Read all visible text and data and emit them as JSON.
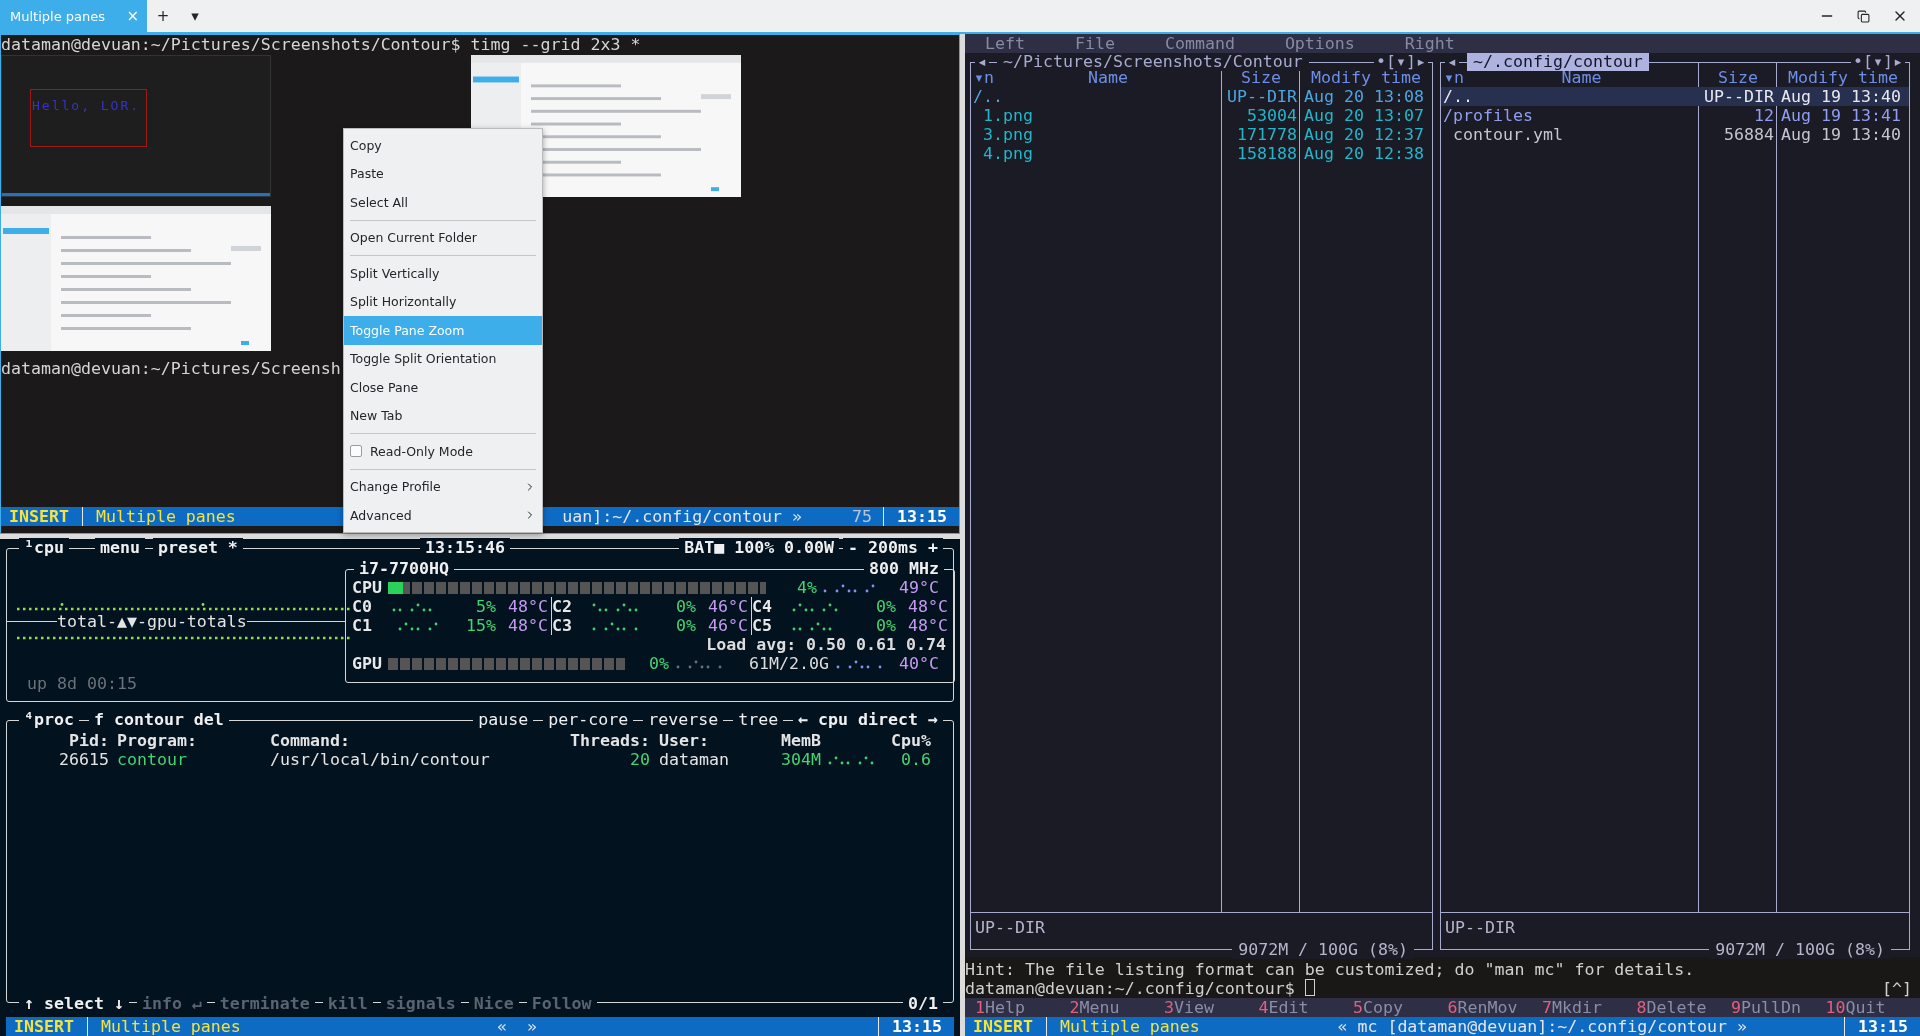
{
  "tab_bar": {
    "tabs": [
      {
        "label": "Multiple panes",
        "selected": true,
        "close": "×"
      }
    ],
    "new_tab": "+",
    "dropdown": "▾"
  },
  "top_pane": {
    "command_line": "dataman@devuan:~/Pictures/Screenshots/Contour$ timg --grid 2x3 *",
    "thumbnails": [
      {
        "kind": "terminal",
        "text": "Hello, LOR."
      },
      {
        "kind": "picture"
      },
      {
        "kind": "picture"
      }
    ],
    "prompt": "dataman@devuan:~/Pictures/Screensh",
    "status": {
      "mode": "INSERT",
      "title": "Multiple panes",
      "middle": "uan]:~/.config/contour »",
      "count": "75",
      "time": "13:15"
    }
  },
  "context_menu": {
    "items": [
      {
        "kind": "item",
        "label": "Copy",
        "selected": false
      },
      {
        "kind": "item",
        "label": "Paste",
        "selected": false
      },
      {
        "kind": "item",
        "label": "Select All",
        "selected": false
      },
      {
        "kind": "separator"
      },
      {
        "kind": "item",
        "label": "Open Current Folder",
        "selected": false
      },
      {
        "kind": "separator"
      },
      {
        "kind": "item",
        "label": "Split Vertically",
        "selected": false
      },
      {
        "kind": "item",
        "label": "Split Horizontally",
        "selected": false
      },
      {
        "kind": "item",
        "label": "Toggle Pane Zoom",
        "selected": true
      },
      {
        "kind": "item",
        "label": "Toggle Split Orientation",
        "selected": false
      },
      {
        "kind": "item",
        "label": "Close Pane",
        "selected": false
      },
      {
        "kind": "item",
        "label": "New Tab",
        "selected": false
      },
      {
        "kind": "separator"
      },
      {
        "kind": "checkbox",
        "label": "Read-Only Mode",
        "checked": false,
        "selected": false
      },
      {
        "kind": "separator"
      },
      {
        "kind": "submenu",
        "label": "Change Profile",
        "selected": false
      },
      {
        "kind": "submenu",
        "label": "Advanced",
        "selected": false
      }
    ]
  },
  "btop": {
    "cpu_box": {
      "titles": [
        "¹cpu",
        "menu",
        "preset *"
      ],
      "clock": "13:15:46",
      "battery": "BAT■ 100% 0.00W",
      "interval": "- 200ms +",
      "graph_label": "total-▲▼-gpu-totals",
      "uptime": "up 8d 00:15",
      "model": "i7-7700HQ",
      "frequency": "800 MHz",
      "cpu": {
        "label": "CPU",
        "level": 0.04,
        "percent": "4%",
        "temp": "49°C"
      },
      "cores": [
        {
          "label": "C0",
          "percent": "5%",
          "temp": "48°C"
        },
        {
          "label": "C2",
          "percent": "0%",
          "temp": "46°C"
        },
        {
          "label": "C4",
          "percent": "0%",
          "temp": "48°C"
        },
        {
          "label": "C1",
          "percent": "15%",
          "temp": "48°C"
        },
        {
          "label": "C3",
          "percent": "0%",
          "temp": "46°C"
        },
        {
          "label": "C5",
          "percent": "0%",
          "temp": "48°C"
        }
      ],
      "load": "Load avg: 0.50 0.61 0.74",
      "gpu": {
        "label": "GPU",
        "level": 0,
        "percent": "0%",
        "memory": "61M/2.0G",
        "temp": "40°C"
      }
    },
    "proc_box": {
      "titles_left": [
        "⁴proc",
        "f contour del"
      ],
      "titles_right": [
        "pause",
        "per-core",
        "reverse",
        "tree",
        "← cpu direct →"
      ],
      "columns": {
        "pid": "Pid:",
        "program": "Program:",
        "command": "Command:",
        "threads": "Threads:",
        "user": "User:",
        "memory": "MemB",
        "cpu": "Cpu%"
      },
      "rows": [
        {
          "pid": "26615",
          "program": "contour",
          "command": "/usr/local/bin/contour",
          "threads": "20",
          "user": "dataman",
          "memory": "304M",
          "cpu": "0.6"
        }
      ],
      "footer": [
        {
          "label": "↑ select ↓",
          "disabled": false
        },
        {
          "label": "info ↵",
          "disabled": true
        },
        {
          "label": "terminate",
          "disabled": true
        },
        {
          "label": "kill",
          "disabled": true
        },
        {
          "label": "signals",
          "disabled": true
        },
        {
          "label": "Nice",
          "disabled": true
        },
        {
          "label": "Follow",
          "disabled": true
        }
      ],
      "count": "0/1"
    },
    "status": {
      "mode": "INSERT",
      "title": "Multiple panes",
      "nav": [
        "«",
        "»"
      ],
      "time": "13:15"
    }
  },
  "mc": {
    "menu": [
      "Left",
      "File",
      "Command",
      "Options",
      "Right"
    ],
    "panels": [
      {
        "path": "~/Pictures/Screenshots/Contour",
        "active": false,
        "left_mark": "◂",
        "right_mark": "•[▾]▸",
        "sort": "▾n",
        "columns": [
          "Name",
          "Size",
          "Modify time"
        ],
        "rows": [
          {
            "kind": "parent",
            "name": "/..",
            "size": "UP--DIR",
            "time": "Aug 20 13:08",
            "selected": false
          },
          {
            "name": "1.png",
            "size": "53004",
            "time": "Aug 20 13:07",
            "selected": false
          },
          {
            "name": "3.png",
            "size": "171778",
            "time": "Aug 20 12:37",
            "selected": false
          },
          {
            "name": "4.png",
            "size": "158188",
            "time": "Aug 20 12:38",
            "selected": false
          }
        ],
        "info": "UP--DIR",
        "disk": "9072M / 100G (8%)"
      },
      {
        "path": "~/.config/contour",
        "active": true,
        "left_mark": "◂",
        "right_mark": "•[▾]▸",
        "sort": "▾n",
        "columns": [
          "Name",
          "Size",
          "Modify time"
        ],
        "rows": [
          {
            "kind": "parent",
            "name": "/..",
            "size": "UP--DIR",
            "time": "Aug 19 13:40",
            "selected": true
          },
          {
            "kind": "dir",
            "name": "/profiles",
            "size": "12",
            "time": "Aug 19 13:41",
            "selected": false
          },
          {
            "kind": "file",
            "name": "contour.yml",
            "size": "56884",
            "time": "Aug 19 13:40",
            "selected": false
          }
        ],
        "info": "UP--DIR",
        "disk": "9072M / 100G (8%)"
      }
    ],
    "hint": "Hint: The file listing format can be customized; do \"man mc\" for details.",
    "prompt": "dataman@devuan:~/.config/contour$",
    "corner": "[^]",
    "function_keys": [
      {
        "key": "1",
        "label": "Help"
      },
      {
        "key": "2",
        "label": "Menu"
      },
      {
        "key": "3",
        "label": "View"
      },
      {
        "key": "4",
        "label": "Edit"
      },
      {
        "key": "5",
        "label": "Copy"
      },
      {
        "key": "6",
        "label": "RenMov"
      },
      {
        "key": "7",
        "label": "Mkdir"
      },
      {
        "key": "8",
        "label": "Delete"
      },
      {
        "key": "9",
        "label": "PullDn"
      },
      {
        "key": "10",
        "label": "Quit"
      }
    ],
    "status": {
      "mode": "INSERT",
      "title": "Multiple panes",
      "middle": "« mc [dataman@devuan]:~/.config/contour »",
      "time": "13:15"
    }
  }
}
